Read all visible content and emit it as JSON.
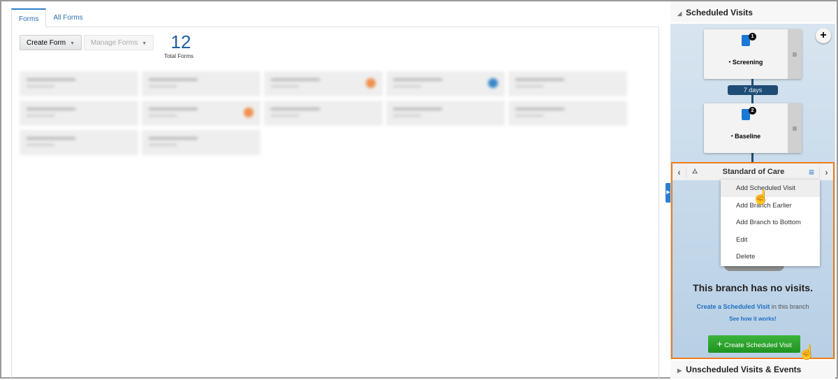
{
  "tabs": [
    {
      "label": "Forms",
      "active": true
    },
    {
      "label": "All Forms",
      "active": false
    }
  ],
  "toolbar": {
    "create_form": "Create Form",
    "manage_forms": "Manage Forms"
  },
  "summary": {
    "count": "12",
    "label": "Total Forms"
  },
  "form_cards": [
    {
      "dot": null
    },
    {
      "dot": null
    },
    {
      "dot": "#f0914f"
    },
    {
      "dot": "#3b88c8"
    },
    {
      "dot": null
    },
    {
      "dot": null
    },
    {
      "dot": "#f0914f"
    },
    {
      "dot": null
    },
    {
      "dot": null
    },
    {
      "dot": null
    },
    {
      "dot": null
    },
    {
      "dot": null
    }
  ],
  "scheduled": {
    "title": "Scheduled Visits",
    "visits": [
      {
        "number": "1",
        "name": "Screening",
        "required": "*"
      },
      {
        "number": "2",
        "name": "Baseline",
        "required": "*"
      }
    ],
    "interval": "7 days",
    "branch": {
      "title": "Standard of Care",
      "menu": [
        "Add Scheduled Visit",
        "Add Branch Earlier",
        "Add Branch to Bottom",
        "Edit",
        "Delete"
      ],
      "empty_title": "This branch has no visits.",
      "create_link": "Create a Scheduled Visit",
      "create_suffix": " in this branch",
      "how_link": "See how it works!",
      "create_button": "Create Scheduled Visit"
    }
  },
  "unscheduled": {
    "title": "Unscheduled Visits & Events"
  },
  "colors": {
    "accent": "#2a7fc8",
    "branch_border": "#f07c1a",
    "create_button": "#25a125",
    "interval": "#1d4c74"
  }
}
